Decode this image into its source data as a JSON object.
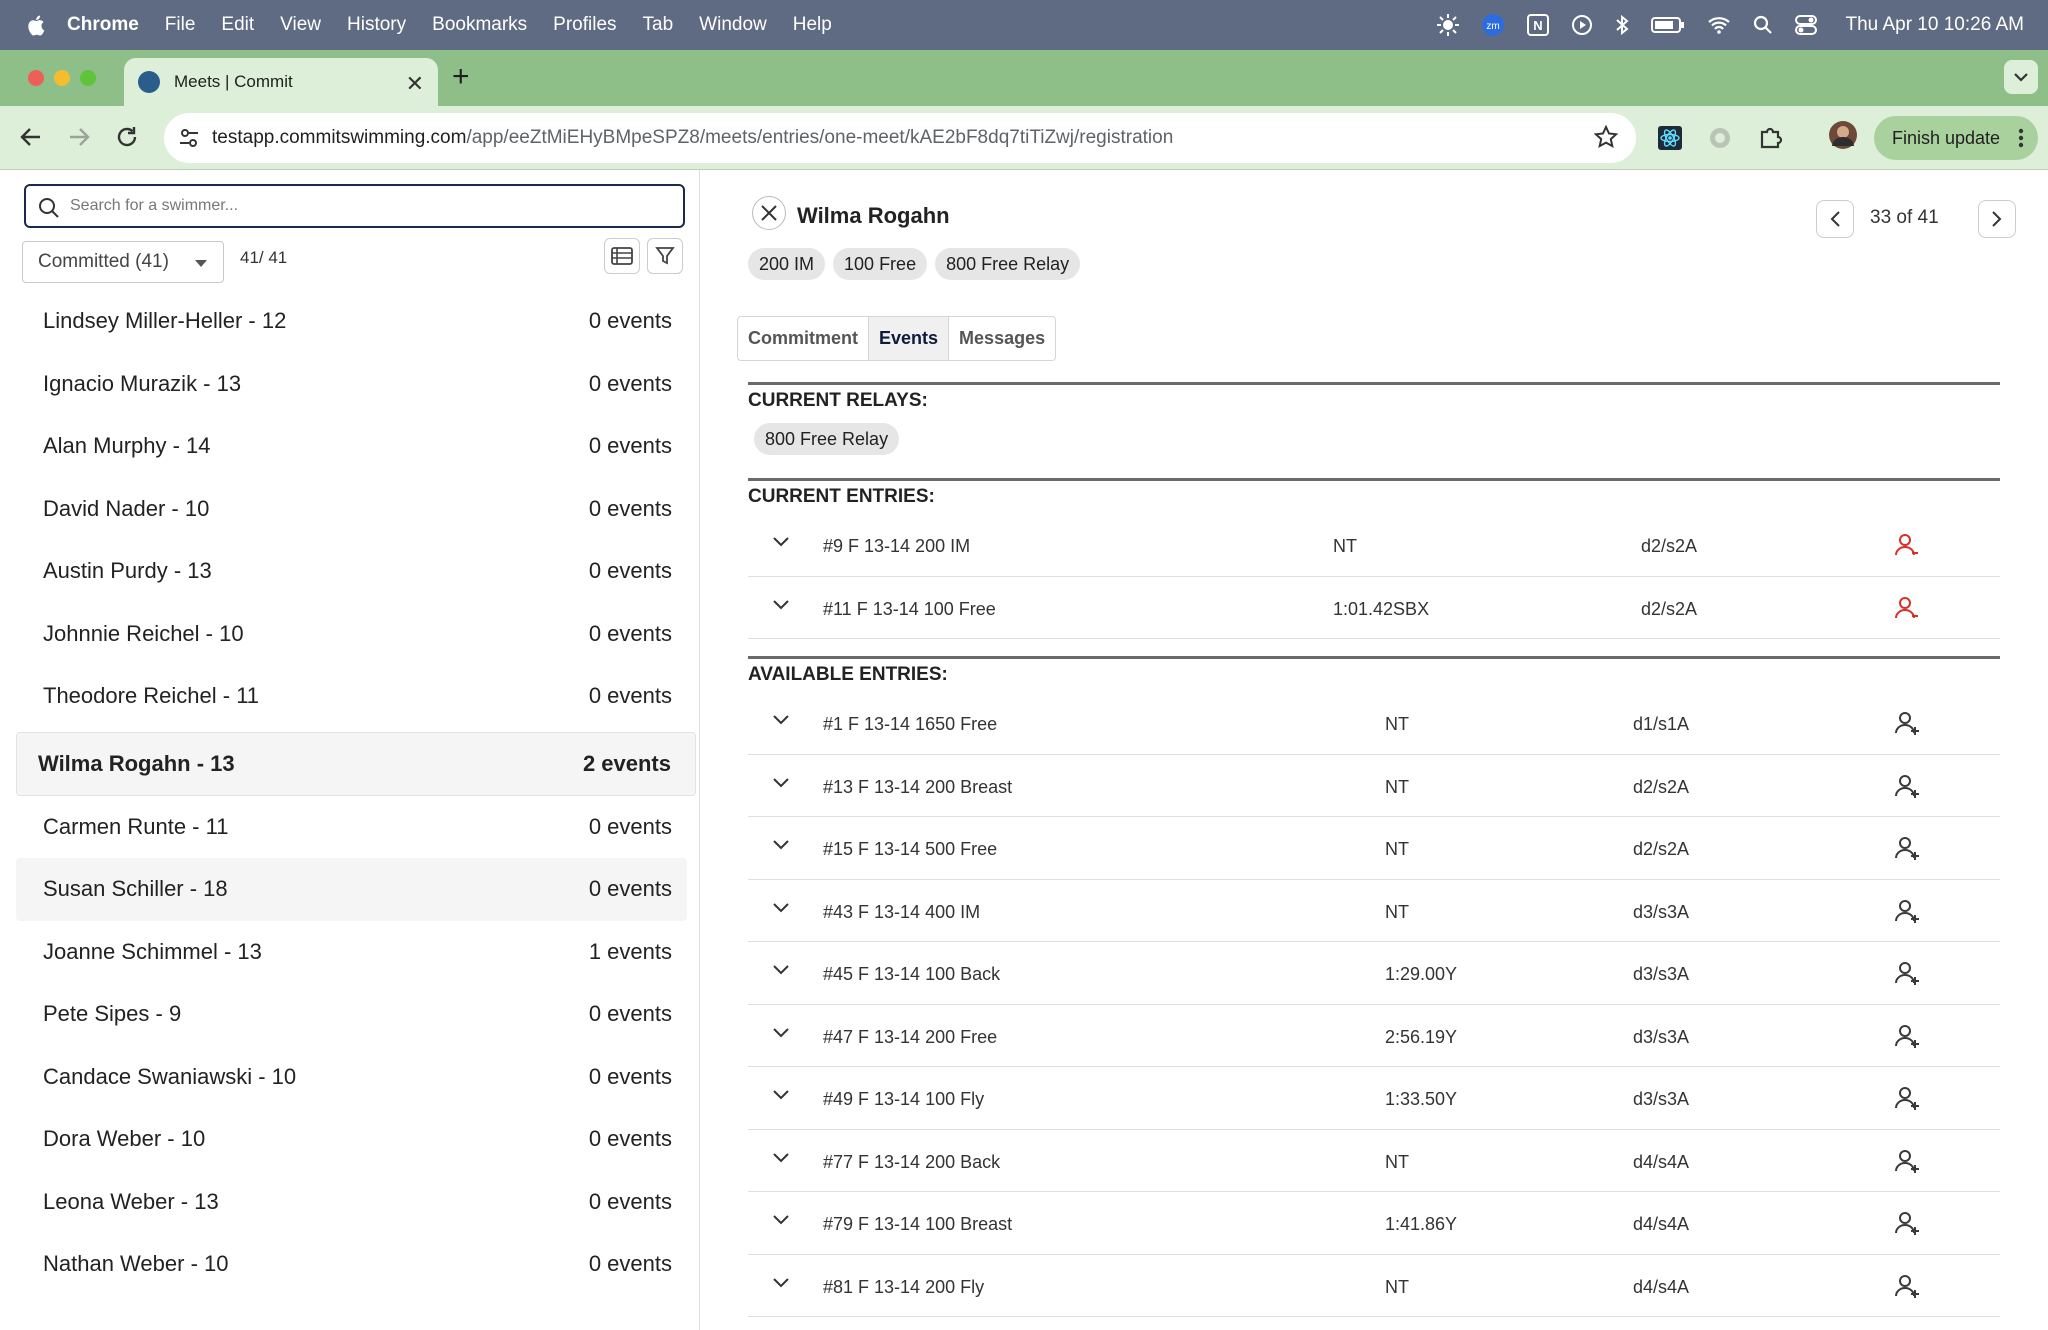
{
  "menubar": {
    "app": "Chrome",
    "items": [
      "File",
      "Edit",
      "View",
      "History",
      "Bookmarks",
      "Profiles",
      "Tab",
      "Window",
      "Help"
    ],
    "clock": "Thu Apr 10  10:26 AM"
  },
  "browser": {
    "tab_title": "Meets | Commit",
    "url_host": "testapp.commitswimming.com",
    "url_path": "/app/eeZtMiEHyBMpeSPZ8/meets/entries/one-meet/kAE2bF8dq7tiTiZwj/registration",
    "finish_update": "Finish update"
  },
  "left": {
    "search_placeholder": "Search for a swimmer...",
    "filter_label": "Committed (41)",
    "count": "41/ 41",
    "swimmers": [
      {
        "name": "Lindsey Miller-Heller - 12",
        "events": "0 events"
      },
      {
        "name": "Ignacio Murazik - 13",
        "events": "0 events"
      },
      {
        "name": "Alan Murphy - 14",
        "events": "0 events"
      },
      {
        "name": "David Nader - 10",
        "events": "0 events"
      },
      {
        "name": "Austin Purdy - 13",
        "events": "0 events"
      },
      {
        "name": "Johnnie Reichel - 10",
        "events": "0 events"
      },
      {
        "name": "Theodore Reichel - 11",
        "events": "0 events"
      },
      {
        "name": "Wilma Rogahn - 13",
        "events": "2 events",
        "selected": true
      },
      {
        "name": "Carmen Runte - 11",
        "events": "0 events"
      },
      {
        "name": "Susan Schiller - 18",
        "events": "0 events",
        "hover": true
      },
      {
        "name": "Joanne Schimmel - 13",
        "events": "1 events"
      },
      {
        "name": "Pete Sipes - 9",
        "events": "0 events"
      },
      {
        "name": "Candace Swaniawski - 10",
        "events": "0 events"
      },
      {
        "name": "Dora Weber - 10",
        "events": "0 events"
      },
      {
        "name": "Leona Weber - 13",
        "events": "0 events"
      },
      {
        "name": "Nathan Weber - 10",
        "events": "0 events"
      }
    ]
  },
  "detail": {
    "name": "Wilma Rogahn",
    "pager": "33 of 41",
    "chips": [
      "200 IM",
      "100 Free",
      "800 Free Relay"
    ],
    "tabs": [
      "Commitment",
      "Events",
      "Messages"
    ],
    "active_tab": "Events",
    "relays_title": "CURRENT RELAYS:",
    "relays": [
      "800 Free Relay"
    ],
    "entries_title": "CURRENT ENTRIES:",
    "current_entries": [
      {
        "event": "#9 F 13-14 200 IM",
        "time": "NT",
        "slot": "d2/s2A"
      },
      {
        "event": "#11 F 13-14 100 Free",
        "time": "1:01.42SBX",
        "slot": "d2/s2A"
      }
    ],
    "available_title": "AVAILABLE ENTRIES:",
    "available_entries": [
      {
        "event": "#1 F 13-14 1650 Free",
        "time": "NT",
        "slot": "d1/s1A"
      },
      {
        "event": "#13 F 13-14 200 Breast",
        "time": "NT",
        "slot": "d2/s2A"
      },
      {
        "event": "#15 F 13-14 500 Free",
        "time": "NT",
        "slot": "d2/s2A"
      },
      {
        "event": "#43 F 13-14 400 IM",
        "time": "NT",
        "slot": "d3/s3A"
      },
      {
        "event": "#45 F 13-14 100 Back",
        "time": "1:29.00Y",
        "slot": "d3/s3A"
      },
      {
        "event": "#47 F 13-14 200 Free",
        "time": "2:56.19Y",
        "slot": "d3/s3A"
      },
      {
        "event": "#49 F 13-14 100 Fly",
        "time": "1:33.50Y",
        "slot": "d3/s3A"
      },
      {
        "event": "#77 F 13-14 200 Back",
        "time": "NT",
        "slot": "d4/s4A"
      },
      {
        "event": "#79 F 13-14 100 Breast",
        "time": "1:41.86Y",
        "slot": "d4/s4A"
      },
      {
        "event": "#81 F 13-14 200 Fly",
        "time": "NT",
        "slot": "d4/s4A"
      }
    ]
  },
  "colors": {
    "remove_icon": "#d93025",
    "add_icon": "#3a3a3a",
    "menubar": "#5e6b82",
    "tabstrip": "#8fbf88",
    "toolbar": "#ddefd8"
  }
}
